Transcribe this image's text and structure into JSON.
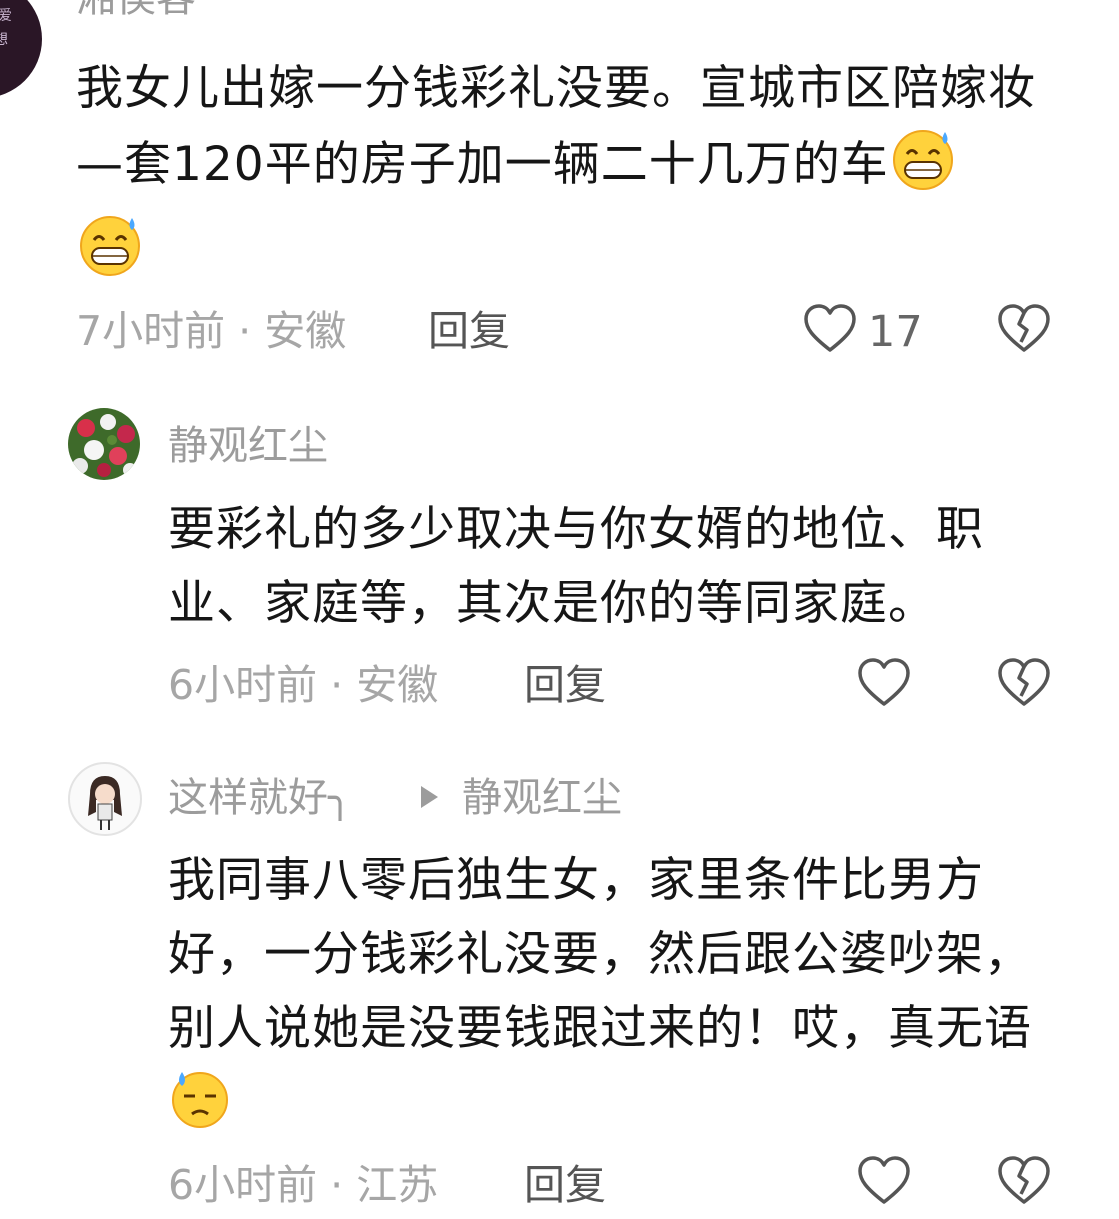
{
  "comments": [
    {
      "username": "湘侯客",
      "text": "我女儿出嫁一分钱彩礼没要。宣城市区陪嫁妆—套120平的房子加一辆二十几万的车",
      "emojis": [
        "grin-sweat-emoji",
        "grin-sweat-emoji"
      ],
      "time": "7小时前",
      "location": "安徽",
      "reply_label": "回复",
      "like_count": "17"
    },
    {
      "username": "静观红尘",
      "text": "要彩礼的多少取决与你女婿的地位、职业、家庭等，其次是你的等同家庭。",
      "time": "6小时前",
      "location": "安徽",
      "reply_label": "回复",
      "like_count": ""
    },
    {
      "username": "这样就好╮",
      "reply_to": "静观红尘",
      "text": "我同事八零后独生女，家里条件比男方好，一分钱彩礼没要，然后跟公婆吵架，别人说她是没要钱跟过来的！哎，真无语",
      "emojis": [
        "downcast-sweat-emoji"
      ],
      "time": "6小时前",
      "location": "江苏",
      "reply_label": "回复",
      "like_count": ""
    }
  ],
  "separator": " · ",
  "colors": {
    "meta": "#a6a6a6",
    "text": "#161616",
    "icon": "#555555"
  }
}
